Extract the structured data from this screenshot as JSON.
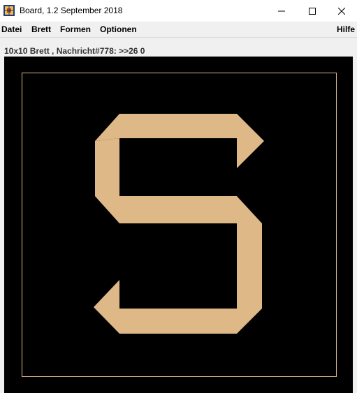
{
  "window": {
    "title": "Board, 1.2 September 2018",
    "app_icon": "board-grid-icon",
    "controls": [
      "minimize-icon",
      "maximize-icon",
      "close-icon"
    ]
  },
  "menubar": {
    "items": [
      "Datei",
      "Brett",
      "Formen",
      "Optionen"
    ],
    "help": "Hilfe"
  },
  "status": {
    "text": "10x10 Brett , Nachricht#778: >>26 0"
  },
  "board": {
    "background": "#000000",
    "frame_color": "#deb887",
    "shape_color": "#deb887",
    "shape": "S"
  }
}
